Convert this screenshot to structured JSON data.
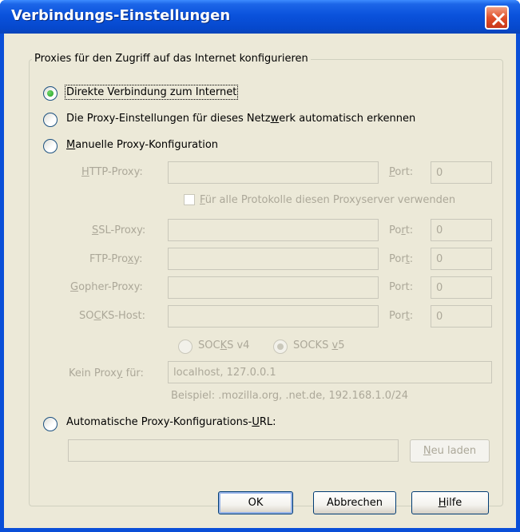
{
  "window": {
    "title": "Verbindungs-Einstellungen"
  },
  "group": {
    "legend": "Proxies für den Zugriff auf das Internet konfigurieren"
  },
  "options": {
    "direct": {
      "label": "Direkte Verbindung zum Internet",
      "selected": true
    },
    "auto_detect": {
      "label_a": "Die Proxy-Einstellungen für dieses Netz",
      "label_ul": "w",
      "label_b": "erk automatisch erkennen",
      "selected": false
    },
    "manual": {
      "label_ul": "M",
      "label_rest": "anuelle Proxy-Konfiguration",
      "selected": false
    },
    "auto_url": {
      "label_a": "Automatische Proxy-Konfigurations-",
      "label_ul": "U",
      "label_b": "RL:",
      "selected": false
    }
  },
  "manual": {
    "http": {
      "label_ul": "H",
      "label_rest": "TTP-Proxy:",
      "value": "",
      "port_label_a": "P",
      "port_label_b": "ort:",
      "port": "0"
    },
    "share_all": {
      "label_ul": "F",
      "label_rest": "ür alle Protokolle diesen Proxyserver verwenden",
      "checked": false
    },
    "ssl": {
      "label_ul": "S",
      "label_rest": "SL-Proxy:",
      "value": "",
      "port_label_a": "Po",
      "port_label_ul": "r",
      "port_label_b": "t:",
      "port": "0"
    },
    "ftp": {
      "label_a": "FTP-Pro",
      "label_ul": "x",
      "label_b": "y:",
      "value": "",
      "port_label_a": "Por",
      "port_label_ul": "t",
      "port_label_b": ":",
      "port": "0"
    },
    "gopher": {
      "label_ul": "G",
      "label_rest": "opher-Proxy:",
      "value": "",
      "port_label": "Port:",
      "port": "0"
    },
    "socks": {
      "label_a": "SO",
      "label_ul": "C",
      "label_b": "KS-Host:",
      "value": "",
      "port_label_a": "Por",
      "port_label_ul": "t",
      "port_label_b": ":",
      "port": "0"
    },
    "socks_v4": {
      "label_a": "SOC",
      "label_ul": "K",
      "label_b": "S v4",
      "selected": false
    },
    "socks_v5": {
      "label_a": "SOCKS ",
      "label_ul": "v",
      "label_b": "5",
      "selected": true
    },
    "no_proxy": {
      "label_a": "Kein Prox",
      "label_ul": "y",
      "label_b": " für:",
      "value": "localhost, 127.0.0.1"
    },
    "example": "Beispiel: .mozilla.org, .net.de, 192.168.1.0/24"
  },
  "auto_url": {
    "value": "",
    "reload_ul": "N",
    "reload_rest": "eu laden"
  },
  "buttons": {
    "ok": "OK",
    "cancel": "Abbrechen",
    "help_ul": "H",
    "help_rest": "ilfe"
  },
  "colors": {
    "title_bar": "#0a52dc",
    "dialog_bg": "#ece9d8",
    "disabled_text": "#aca899",
    "close_button": "#e0502a"
  }
}
